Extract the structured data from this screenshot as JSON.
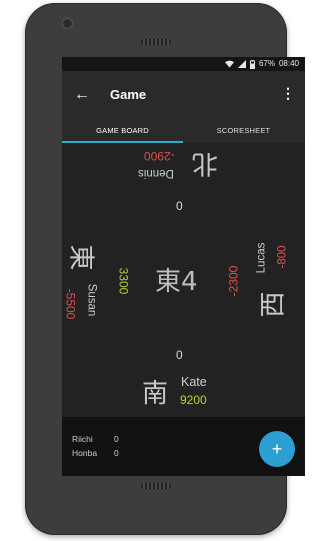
{
  "statusbar": {
    "wifi_icon": "wifi-icon",
    "signal_icon": "signal-icon",
    "battery_icon": "battery-icon",
    "battery": "67%",
    "time": "08:40"
  },
  "appbar": {
    "back_icon": "←",
    "title": "Game",
    "menu_icon": "⋮"
  },
  "tabs": [
    {
      "label": "GAME BOARD",
      "active": true
    },
    {
      "label": "SCORESHEET",
      "active": false
    }
  ],
  "board": {
    "round": "東4",
    "players": {
      "top": {
        "wind": "北",
        "name": "Dennis",
        "score": "-2900",
        "pot": "0"
      },
      "left": {
        "wind": "東",
        "name": "Susan",
        "score": "-5500",
        "pot": "3300"
      },
      "right": {
        "wind": "西",
        "name": "Lucas",
        "score": "-800",
        "pot": "-2300"
      },
      "bottom": {
        "wind": "南",
        "name": "Kate",
        "score": "9200",
        "pot": "0"
      }
    }
  },
  "footer": {
    "riichi_label": "Riichi",
    "riichi_value": "0",
    "honba_label": "Honba",
    "honba_value": "0",
    "fab_icon": "+"
  },
  "colors": {
    "accent": "#2b9fd2",
    "negative": "#e0514f",
    "positive": "#b7d23a",
    "background": "#1f1f1f"
  }
}
